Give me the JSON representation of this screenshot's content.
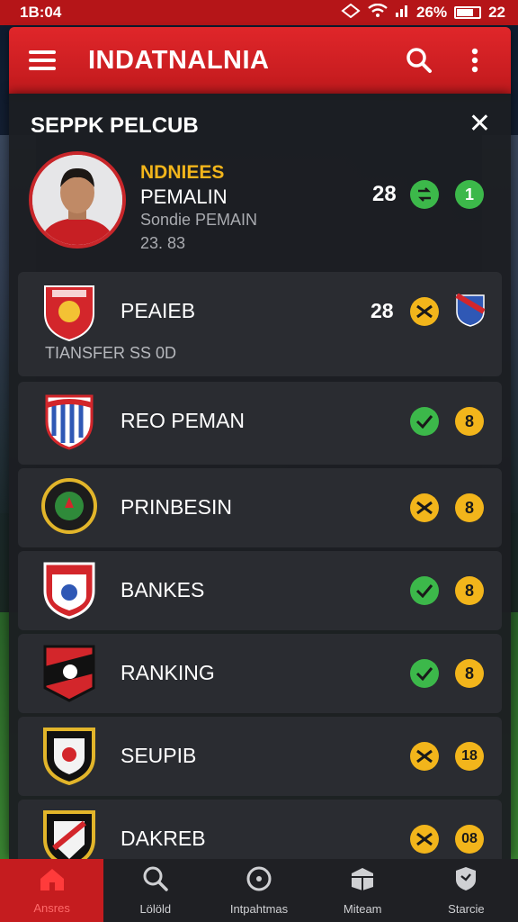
{
  "status": {
    "time": "1B:04",
    "battery": "26%",
    "extra": "22"
  },
  "appbar": {
    "title": "INDATNALNIA"
  },
  "panel": {
    "title": "SEPPK PELCUB",
    "profile": {
      "name_line1": "NDNIEES",
      "name_line2": "PEMALIN",
      "subtitle": "Sondie PEMAIN",
      "number": "23. 83",
      "score": "28",
      "badge2": "1"
    },
    "featured": {
      "label": "PEAIEB",
      "sublabel": "TIANSFER SS 0D",
      "score": "28"
    },
    "rows": [
      {
        "label": "REO PEMAN",
        "badge": "8"
      },
      {
        "label": "PRINBESIN",
        "badge": "8"
      },
      {
        "label": "BANKES",
        "badge": "8"
      },
      {
        "label": "RANKING",
        "badge": "8"
      },
      {
        "label": "SEUPIB",
        "badge": "18"
      },
      {
        "label": "DAKREB",
        "badge": "08"
      }
    ]
  },
  "nav": [
    {
      "label": "Ansres"
    },
    {
      "label": "Lölöld"
    },
    {
      "label": "Intpahtmas"
    },
    {
      "label": "Miteam"
    },
    {
      "label": "Starcie"
    }
  ],
  "colors": {
    "brand": "#c51c1f",
    "gold": "#f2b51b",
    "green": "#3cb84a"
  }
}
